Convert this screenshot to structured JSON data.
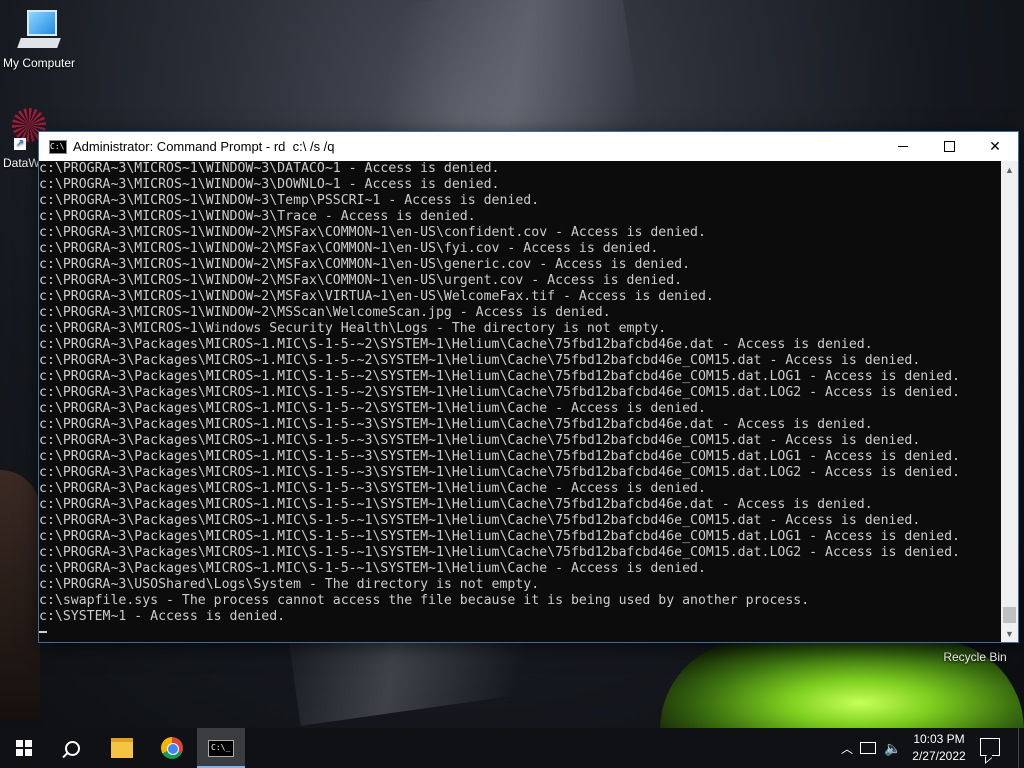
{
  "desktop": {
    "icons": [
      {
        "label": "My Computer"
      },
      {
        "label": "DataW"
      },
      {
        "label": "Recycle Bin"
      }
    ]
  },
  "window": {
    "title": "Administrator: Command Prompt - rd  c:\\ /s /q",
    "console_lines": [
      "c:\\PROGRA~3\\MICROS~1\\WINDOW~3\\DATACO~1 - Access is denied.",
      "c:\\PROGRA~3\\MICROS~1\\WINDOW~3\\DOWNLO~1 - Access is denied.",
      "c:\\PROGRA~3\\MICROS~1\\WINDOW~3\\Temp\\PSSCRI~1 - Access is denied.",
      "c:\\PROGRA~3\\MICROS~1\\WINDOW~3\\Trace - Access is denied.",
      "c:\\PROGRA~3\\MICROS~1\\WINDOW~2\\MSFax\\COMMON~1\\en-US\\confident.cov - Access is denied.",
      "c:\\PROGRA~3\\MICROS~1\\WINDOW~2\\MSFax\\COMMON~1\\en-US\\fyi.cov - Access is denied.",
      "c:\\PROGRA~3\\MICROS~1\\WINDOW~2\\MSFax\\COMMON~1\\en-US\\generic.cov - Access is denied.",
      "c:\\PROGRA~3\\MICROS~1\\WINDOW~2\\MSFax\\COMMON~1\\en-US\\urgent.cov - Access is denied.",
      "c:\\PROGRA~3\\MICROS~1\\WINDOW~2\\MSFax\\VIRTUA~1\\en-US\\WelcomeFax.tif - Access is denied.",
      "c:\\PROGRA~3\\MICROS~1\\WINDOW~2\\MSScan\\WelcomeScan.jpg - Access is denied.",
      "c:\\PROGRA~3\\MICROS~1\\Windows Security Health\\Logs - The directory is not empty.",
      "c:\\PROGRA~3\\Packages\\MICROS~1.MIC\\S-1-5-~2\\SYSTEM~1\\Helium\\Cache\\75fbd12bafcbd46e.dat - Access is denied.",
      "c:\\PROGRA~3\\Packages\\MICROS~1.MIC\\S-1-5-~2\\SYSTEM~1\\Helium\\Cache\\75fbd12bafcbd46e_COM15.dat - Access is denied.",
      "c:\\PROGRA~3\\Packages\\MICROS~1.MIC\\S-1-5-~2\\SYSTEM~1\\Helium\\Cache\\75fbd12bafcbd46e_COM15.dat.LOG1 - Access is denied.",
      "c:\\PROGRA~3\\Packages\\MICROS~1.MIC\\S-1-5-~2\\SYSTEM~1\\Helium\\Cache\\75fbd12bafcbd46e_COM15.dat.LOG2 - Access is denied.",
      "c:\\PROGRA~3\\Packages\\MICROS~1.MIC\\S-1-5-~2\\SYSTEM~1\\Helium\\Cache - Access is denied.",
      "c:\\PROGRA~3\\Packages\\MICROS~1.MIC\\S-1-5-~3\\SYSTEM~1\\Helium\\Cache\\75fbd12bafcbd46e.dat - Access is denied.",
      "c:\\PROGRA~3\\Packages\\MICROS~1.MIC\\S-1-5-~3\\SYSTEM~1\\Helium\\Cache\\75fbd12bafcbd46e_COM15.dat - Access is denied.",
      "c:\\PROGRA~3\\Packages\\MICROS~1.MIC\\S-1-5-~3\\SYSTEM~1\\Helium\\Cache\\75fbd12bafcbd46e_COM15.dat.LOG1 - Access is denied.",
      "c:\\PROGRA~3\\Packages\\MICROS~1.MIC\\S-1-5-~3\\SYSTEM~1\\Helium\\Cache\\75fbd12bafcbd46e_COM15.dat.LOG2 - Access is denied.",
      "c:\\PROGRA~3\\Packages\\MICROS~1.MIC\\S-1-5-~3\\SYSTEM~1\\Helium\\Cache - Access is denied.",
      "c:\\PROGRA~3\\Packages\\MICROS~1.MIC\\S-1-5-~1\\SYSTEM~1\\Helium\\Cache\\75fbd12bafcbd46e.dat - Access is denied.",
      "c:\\PROGRA~3\\Packages\\MICROS~1.MIC\\S-1-5-~1\\SYSTEM~1\\Helium\\Cache\\75fbd12bafcbd46e_COM15.dat - Access is denied.",
      "c:\\PROGRA~3\\Packages\\MICROS~1.MIC\\S-1-5-~1\\SYSTEM~1\\Helium\\Cache\\75fbd12bafcbd46e_COM15.dat.LOG1 - Access is denied.",
      "c:\\PROGRA~3\\Packages\\MICROS~1.MIC\\S-1-5-~1\\SYSTEM~1\\Helium\\Cache\\75fbd12bafcbd46e_COM15.dat.LOG2 - Access is denied.",
      "c:\\PROGRA~3\\Packages\\MICROS~1.MIC\\S-1-5-~1\\SYSTEM~1\\Helium\\Cache - Access is denied.",
      "c:\\PROGRA~3\\USOShared\\Logs\\System - The directory is not empty.",
      "c:\\swapfile.sys - The process cannot access the file because it is being used by another process.",
      "c:\\SYSTEM~1 - Access is denied."
    ],
    "buttons": {
      "minimize": "minimize",
      "maximize": "maximize",
      "close": "✕"
    }
  },
  "taskbar": {
    "apps": [
      "start",
      "search",
      "file-explorer",
      "chrome",
      "command-prompt"
    ],
    "active_app": "command-prompt",
    "tray": {
      "time": "10:03 PM",
      "date": "2/27/2022",
      "icons": [
        "chevron-up-icon",
        "network-icon",
        "volume-icon",
        "notification-icon"
      ]
    }
  },
  "colors": {
    "console_bg": "#0c0c0c",
    "console_text": "#cccccc",
    "taskbar_bg": "#101114",
    "active_underline": "#7eb4ea"
  }
}
